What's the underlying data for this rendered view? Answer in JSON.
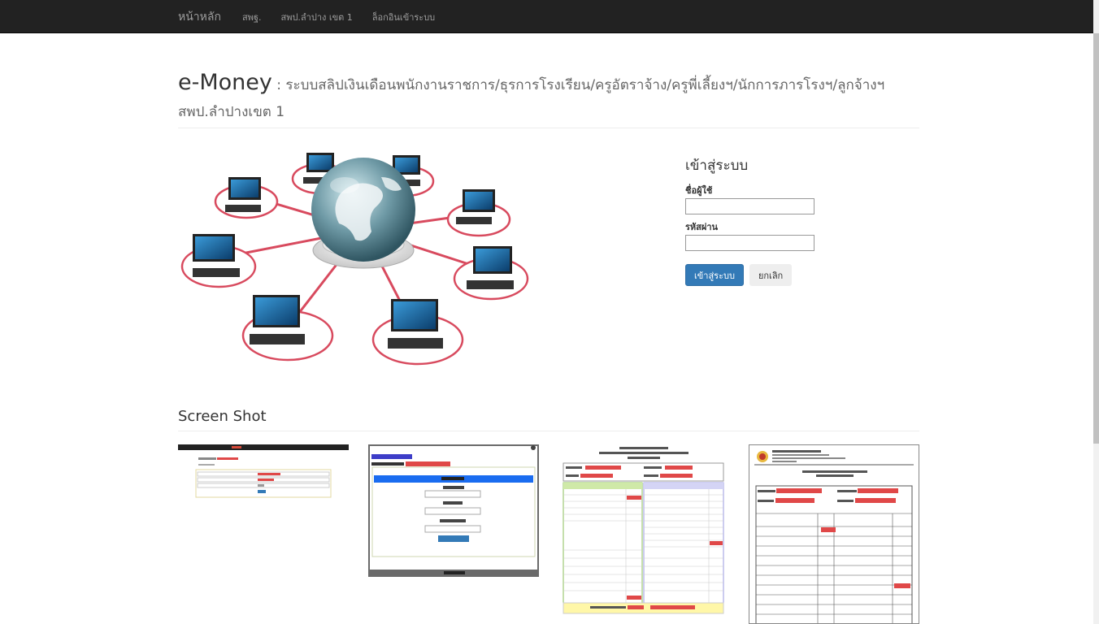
{
  "nav": {
    "brand": "หน้าหลัก",
    "links": [
      "สพฐ.",
      "สพป.ลำปาง เขต 1",
      "ล็อกอินเข้าระบบ"
    ]
  },
  "header": {
    "title": "e-Money",
    "subtitle": " : ระบบสลิปเงินเดือนพนักงานราชการ/ธุรการโรงเรียน/ครูอัตราจ้าง/ครูพี่เลี้ยงฯ/นักการภารโรงฯ/ลูกจ้างฯ",
    "line2": "สพป.ลำปางเขต 1"
  },
  "hero": {
    "icon": "network-globe-illustration"
  },
  "login": {
    "heading": "เข้าสู่ระบบ",
    "username_label": "ชื่อผู้ใช้",
    "username_value": "",
    "password_label": "รหัสผ่าน",
    "password_value": "",
    "submit_label": "เข้าสู่ระบบ",
    "cancel_label": "ยกเลิก"
  },
  "screenshots": {
    "title": "Screen Shot",
    "count": 4
  },
  "colors": {
    "navbar": "#222222",
    "primary": "#337ab7",
    "ring": "#e0606e",
    "red_mark": "#e04848"
  }
}
